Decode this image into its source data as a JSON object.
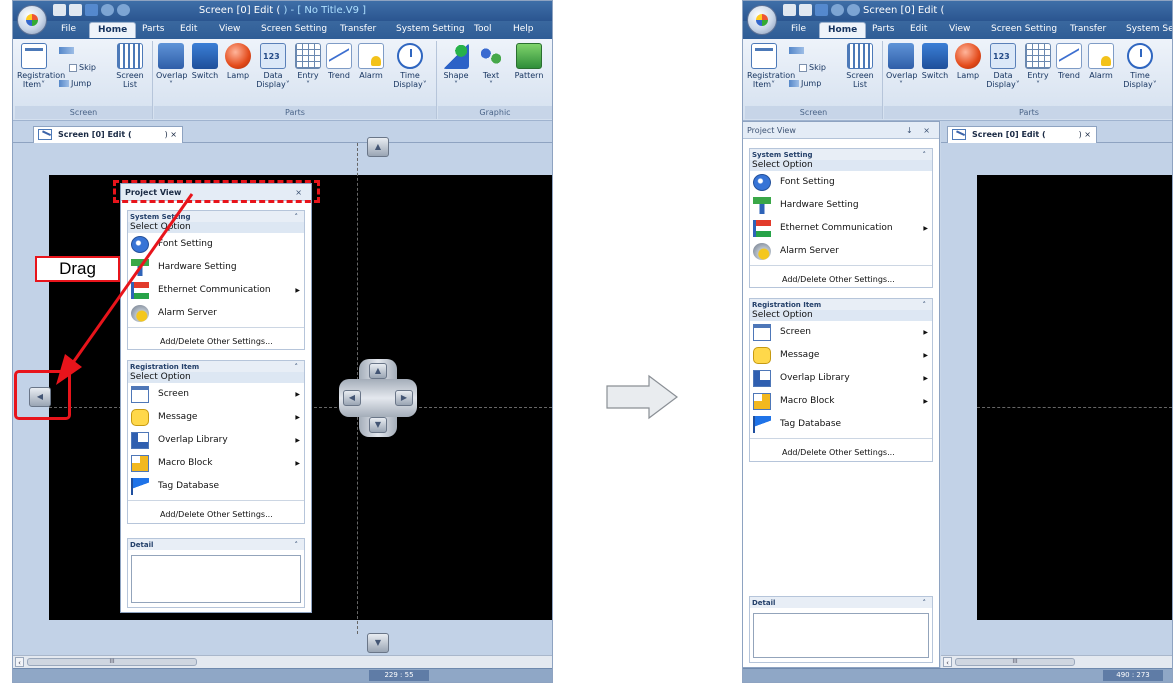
{
  "left_window": {
    "title": "Screen [0] Edit (",
    "title_suffix": ") - [ No Title.V9 ]",
    "menu": [
      "File",
      "Home",
      "Parts",
      "Edit",
      "View",
      "Screen Setting",
      "Transfer",
      "System Setting",
      "Tool",
      "Help"
    ],
    "active_menu": "Home",
    "ribbon": {
      "screen_group_label": "Screen",
      "parts_group_label": "Parts",
      "graphic_group_label": "Graphic",
      "registration_item": "Registration",
      "registration_item2": "Item˅",
      "skip": "Skip",
      "jump": "Jump",
      "screen_list": "Screen",
      "screen_list2": "List",
      "overlap": "Overlap",
      "switch": "Switch",
      "lamp": "Lamp",
      "data_display": "Data",
      "data_display2": "Display˅",
      "entry": "Entry",
      "trend": "Trend",
      "alarm": "Alarm",
      "time_display": "Time",
      "time_display2": "Display˅",
      "shape": "Shape",
      "text": "Text",
      "pattern": "Pattern"
    },
    "doc_tab": "Screen [0] Edit (",
    "doc_tab_close": ")  ×",
    "status_coord": "229 : 55",
    "scroll_thumb": "III"
  },
  "floating_panel": {
    "title": "Project View",
    "close": "×",
    "system_setting": {
      "header": "System Setting",
      "select_option": "Select Option",
      "items": [
        "Font Setting",
        "Hardware Setting",
        "Ethernet Communication",
        "Alarm Server"
      ],
      "add_delete": "Add/Delete Other Settings..."
    },
    "registration_item": {
      "header": "Registration Item",
      "select_option": "Select Option",
      "items": [
        "Screen",
        "Message",
        "Overlap Library",
        "Macro Block",
        "Tag Database"
      ],
      "add_delete": "Add/Delete Other Settings..."
    },
    "detail": "Detail"
  },
  "annotation": {
    "drag_label": "Drag",
    "accent_color": "#e8141b"
  },
  "right_window": {
    "title": "Screen [0] Edit (",
    "menu": [
      "File",
      "Home",
      "Parts",
      "Edit",
      "View",
      "Screen Setting",
      "Transfer",
      "System Setti"
    ],
    "ribbon": {
      "screen_group_label": "Screen",
      "parts_group_label": "Parts",
      "registration_item": "Registration",
      "registration_item2": "Item˅",
      "skip": "Skip",
      "jump": "Jump",
      "screen_list": "Screen",
      "screen_list2": "List",
      "overlap": "Overlap",
      "switch": "Switch",
      "lamp": "Lamp",
      "data_display": "Data",
      "data_display2": "Display˅",
      "entry": "Entry",
      "trend": "Trend",
      "alarm": "Alarm",
      "time_display": "Time",
      "time_display2": "Display˅"
    },
    "panel_title": "Project View",
    "panel_buttons": "↓ ×",
    "doc_tab": "Screen [0] Edit (",
    "doc_tab_close": ")  ×",
    "status_coord": "490 : 273",
    "scroll_thumb": "III"
  }
}
